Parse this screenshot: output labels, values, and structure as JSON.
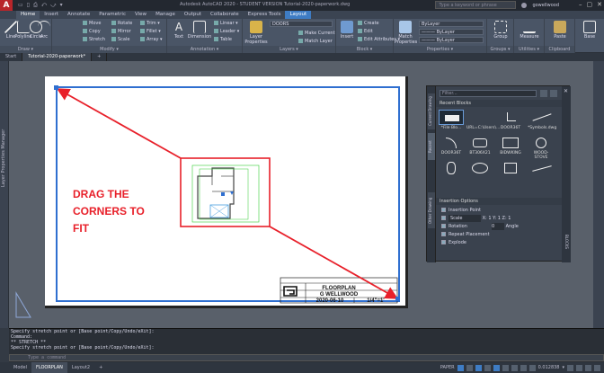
{
  "app": {
    "logo": "A",
    "title": "Autodesk AutoCAD 2020 - STUDENT VERSION    Tutorial-2020-paperwork.dwg",
    "search_placeholder": "Type a keyword or phrase",
    "user": "gowellwood"
  },
  "qat_items": [
    "▭",
    "▯",
    "⎙",
    "⤺",
    "⤻",
    "▾"
  ],
  "ribbon_tabs": [
    "Home",
    "Insert",
    "Annotate",
    "Parametric",
    "View",
    "Manage",
    "Output",
    "Collaborate",
    "Express Tools",
    "Layout"
  ],
  "ribbon": {
    "draw": {
      "label": "Draw ▾",
      "buttons": [
        "Line",
        "Polyline",
        "Circle",
        "Arc"
      ]
    },
    "modify": {
      "label": "Modify ▾",
      "items": [
        "Move",
        "Rotate",
        "Trim ▾",
        "Copy",
        "Mirror",
        "Fillet ▾",
        "Stretch",
        "Scale",
        "Array ▾"
      ]
    },
    "annotation": {
      "label": "Annotation ▾",
      "buttons": [
        "Text",
        "Dimension"
      ],
      "items": [
        "Linear ▾",
        "Leader ▾",
        "Table"
      ]
    },
    "layers": {
      "label": "Layers ▾",
      "button": "Layer Properties",
      "combo": "DOORS",
      "items": [
        "Make Current",
        "Match Layer"
      ]
    },
    "block": {
      "label": "Block ▾",
      "button": "Insert",
      "items": [
        "Create",
        "Edit",
        "Edit Attributes ▾"
      ]
    },
    "properties": {
      "label": "Properties ▾",
      "button": "Match Properties",
      "combos": [
        "ByLayer",
        "——— ByLayer",
        "——— ByLayer"
      ]
    },
    "groups": {
      "label": "Groups ▾",
      "button": "Group"
    },
    "utilities": {
      "label": "Utilities ▾",
      "button": "Measure"
    },
    "clipboard": {
      "label": "Clipboard",
      "button": "Paste"
    },
    "view": {
      "button": "Base"
    }
  },
  "doc_tabs": [
    "Start",
    "Tutorial-2020-paperwork*",
    "+"
  ],
  "left_palette": {
    "label": "Layer Properties Manager"
  },
  "drawing": {
    "annotation_lines": [
      "DRAG THE",
      "CORNERS TO",
      "FIT"
    ],
    "colors": {
      "annotation": "#e8202a",
      "viewport": "#2f6fd0",
      "grip": "#2f6fd0",
      "plan": "#33cc33"
    },
    "title_block": {
      "title": "FLOORPLAN",
      "author": "G WELLWOOD",
      "date": "2020-06-10",
      "scale": "1/4\"=1'"
    }
  },
  "blocks_palette": {
    "filter": "Filter...",
    "side_tabs": [
      "Current Drawing",
      "Recent",
      "Other Drawing"
    ],
    "recent_label": "Recent Blocks",
    "recent_items": [
      "*File Blo...",
      "URL=C:\\Users\\...",
      "",
      "",
      "DOOR36T",
      "*Symbols.dwg",
      "DOOR36T",
      "BT306X21",
      "BIDWKING",
      "WOOD-STOVE",
      "",
      "",
      "",
      ""
    ],
    "options_label": "Insertion Options",
    "options": {
      "insertion_point": "Insertion Point",
      "scale": "Scale",
      "scale_x_label": "X:",
      "scale_x": "1",
      "scale_y_label": "Y:",
      "scale_y": "1",
      "scale_z_label": "Z:",
      "scale_z": "1",
      "rotation": "Rotation",
      "rotation_val": "0",
      "angle": "Angle",
      "repeat": "Repeat Placement",
      "explode": "Explode"
    },
    "right_label": "BLOCKS"
  },
  "command": {
    "history": [
      "Specify stretch point or [Base point/Copy/Undo/eXit]:",
      "Command:",
      "** STRETCH **",
      "Specify stretch point or [Base point/Copy/Undo/eXit]:"
    ],
    "placeholder": "Type a command"
  },
  "status": {
    "layout_tabs": [
      "Model",
      "FLOORPLAN",
      "Layout2",
      "+"
    ],
    "paper": "PAPER",
    "scale": "0.012838",
    "zoom": "▾"
  }
}
